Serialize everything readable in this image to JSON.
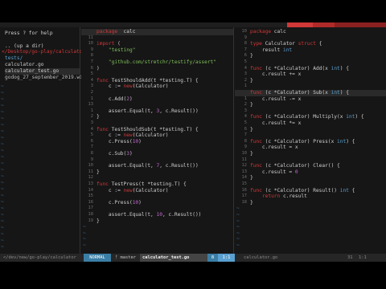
{
  "tabs": [
    "",
    "",
    ""
  ],
  "tree": {
    "help": "Press ? for help",
    "up": ".. (up a dir)",
    "path": "</Desktop/go-play/calculator/",
    "dir": "tests/",
    "files": [
      "calculator.go",
      "calculator_test.go"
    ],
    "wiki": "godog_27_september_2019.wiki"
  },
  "left": {
    "lines": [
      {
        "n": "12",
        "t": [
          [
            "kw",
            "package"
          ],
          [
            "",
            "  calc"
          ]
        ],
        "cur": true
      },
      {
        "n": "11",
        "t": []
      },
      {
        "n": "10",
        "t": [
          [
            "kw",
            "import"
          ],
          [
            "",
            " ("
          ]
        ]
      },
      {
        "n": "9",
        "t": [
          [
            "str",
            "    \"testing\""
          ]
        ]
      },
      {
        "n": "8",
        "t": []
      },
      {
        "n": "7",
        "t": [
          [
            "str",
            "    \"github.com/stretchr/testify/assert\""
          ]
        ]
      },
      {
        "n": "6",
        "t": [
          [
            "",
            ")"
          ]
        ]
      },
      {
        "n": "5",
        "t": []
      },
      {
        "n": "4",
        "t": [
          [
            "kw",
            "func"
          ],
          [
            "",
            " TestShouldAdd(t *testing.T) {"
          ]
        ]
      },
      {
        "n": "3",
        "t": [
          [
            "",
            "    c := "
          ],
          [
            "kw",
            "new"
          ],
          [
            "",
            "(Calculator)"
          ]
        ]
      },
      {
        "n": "2",
        "t": []
      },
      {
        "n": "1",
        "t": [
          [
            "",
            "    c.Add("
          ],
          [
            "num",
            "2"
          ],
          [
            "",
            ")"
          ]
        ]
      },
      {
        "n": "13",
        "t": []
      },
      {
        "n": "1",
        "t": [
          [
            "",
            "    assert.Equal(t, "
          ],
          [
            "num",
            "3"
          ],
          [
            "",
            ", c.Result())"
          ]
        ]
      },
      {
        "n": "2",
        "t": [
          [
            "",
            "}"
          ]
        ]
      },
      {
        "n": "3",
        "t": []
      },
      {
        "n": "4",
        "t": [
          [
            "kw",
            "func"
          ],
          [
            "",
            " TestShouldSub(t *testing.T) {"
          ]
        ]
      },
      {
        "n": "5",
        "t": [
          [
            "",
            "    c := "
          ],
          [
            "kw",
            "new"
          ],
          [
            "",
            "(Calculator)"
          ]
        ]
      },
      {
        "n": "6",
        "t": [
          [
            "",
            "    c.Press("
          ],
          [
            "num",
            "10"
          ],
          [
            "",
            ")"
          ]
        ]
      },
      {
        "n": "7",
        "t": []
      },
      {
        "n": "8",
        "t": [
          [
            "",
            "    c.Sub("
          ],
          [
            "num",
            "3"
          ],
          [
            "",
            ")"
          ]
        ]
      },
      {
        "n": "9",
        "t": []
      },
      {
        "n": "10",
        "t": [
          [
            "",
            "    assert.Equal(t, "
          ],
          [
            "num",
            "7"
          ],
          [
            "",
            ", c.Result())"
          ]
        ]
      },
      {
        "n": "11",
        "t": [
          [
            "",
            "}"
          ]
        ]
      },
      {
        "n": "12",
        "t": []
      },
      {
        "n": "13",
        "t": [
          [
            "kw",
            "func"
          ],
          [
            "",
            " TestPress(t *testing.T) {"
          ]
        ]
      },
      {
        "n": "14",
        "t": [
          [
            "",
            "    c := "
          ],
          [
            "kw",
            "new"
          ],
          [
            "",
            "(Calculator)"
          ]
        ]
      },
      {
        "n": "15",
        "t": []
      },
      {
        "n": "16",
        "t": [
          [
            "",
            "    c.Press("
          ],
          [
            "num",
            "10"
          ],
          [
            "",
            ")"
          ]
        ]
      },
      {
        "n": "17",
        "t": []
      },
      {
        "n": "18",
        "t": [
          [
            "",
            "    assert.Equal(t, "
          ],
          [
            "num",
            "10"
          ],
          [
            "",
            ", c.Result())"
          ]
        ]
      },
      {
        "n": "19",
        "t": [
          [
            "",
            "}"
          ]
        ]
      }
    ]
  },
  "right": {
    "lines": [
      {
        "n": "10",
        "t": [
          [
            "kw",
            "package"
          ],
          [
            "",
            " calc"
          ]
        ]
      },
      {
        "n": "9",
        "t": []
      },
      {
        "n": "8",
        "t": [
          [
            "kw",
            "type"
          ],
          [
            "",
            " Calculator "
          ],
          [
            "kw",
            "struct"
          ],
          [
            "",
            " {"
          ]
        ]
      },
      {
        "n": "7",
        "t": [
          [
            "",
            "    result "
          ],
          [
            "typ",
            "int"
          ]
        ]
      },
      {
        "n": "6",
        "t": [
          [
            "",
            "}"
          ]
        ]
      },
      {
        "n": "5",
        "t": []
      },
      {
        "n": "4",
        "t": [
          [
            "kw",
            "func"
          ],
          [
            "",
            " (c *Calculator) Add(x "
          ],
          [
            "typ",
            "int"
          ],
          [
            "",
            ") {"
          ]
        ]
      },
      {
        "n": "3",
        "t": [
          [
            "",
            "    c.result += x"
          ]
        ]
      },
      {
        "n": "2",
        "t": [
          [
            "",
            "}"
          ]
        ]
      },
      {
        "n": "1",
        "t": []
      },
      {
        "n": "11",
        "t": [
          [
            "kw",
            "func"
          ],
          [
            "",
            " (c *Calculator) Sub(x "
          ],
          [
            "typ",
            "int"
          ],
          [
            "",
            ") {"
          ]
        ],
        "cur": true
      },
      {
        "n": "1",
        "t": [
          [
            "",
            "    c.result -= x"
          ]
        ]
      },
      {
        "n": "2",
        "t": [
          [
            "",
            "}"
          ]
        ]
      },
      {
        "n": "3",
        "t": []
      },
      {
        "n": "4",
        "t": [
          [
            "kw",
            "func"
          ],
          [
            "",
            " (c *Calculator) Multiply(x "
          ],
          [
            "typ",
            "int"
          ],
          [
            "",
            ") {"
          ]
        ]
      },
      {
        "n": "5",
        "t": [
          [
            "",
            "    c.result *= x"
          ]
        ]
      },
      {
        "n": "6",
        "t": [
          [
            "",
            "}"
          ]
        ]
      },
      {
        "n": "7",
        "t": []
      },
      {
        "n": "8",
        "t": [
          [
            "kw",
            "func"
          ],
          [
            "",
            " (c *Calculator) Press(x "
          ],
          [
            "typ",
            "int"
          ],
          [
            "",
            ") {"
          ]
        ]
      },
      {
        "n": "9",
        "t": [
          [
            "",
            "    c.result = x"
          ]
        ]
      },
      {
        "n": "10",
        "t": [
          [
            "",
            "}"
          ]
        ]
      },
      {
        "n": "11",
        "t": []
      },
      {
        "n": "12",
        "t": [
          [
            "kw",
            "func"
          ],
          [
            "",
            " (c *Calculator) Clear() {"
          ]
        ]
      },
      {
        "n": "13",
        "t": [
          [
            "",
            "    c.result = "
          ],
          [
            "num",
            "0"
          ]
        ]
      },
      {
        "n": "14",
        "t": [
          [
            "",
            "}"
          ]
        ]
      },
      {
        "n": "15",
        "t": []
      },
      {
        "n": "16",
        "t": [
          [
            "kw",
            "func"
          ],
          [
            "",
            " (c *Calculator) Result() "
          ],
          [
            "typ",
            "int"
          ],
          [
            "",
            " {"
          ]
        ]
      },
      {
        "n": "17",
        "t": [
          [
            "kw",
            "    return"
          ],
          [
            "",
            " c.result"
          ]
        ]
      },
      {
        "n": "18",
        "t": [
          [
            "",
            "}"
          ]
        ]
      }
    ]
  },
  "status": {
    "tree": "</dev/new/go-play/calculator",
    "mode": "NORMAL",
    "branch": "master",
    "file": "calculator_test.go",
    "pct": "8",
    "pos": "1:1",
    "rfile": "calculator.go",
    "rpct": "31",
    "rpos": "1:1"
  }
}
